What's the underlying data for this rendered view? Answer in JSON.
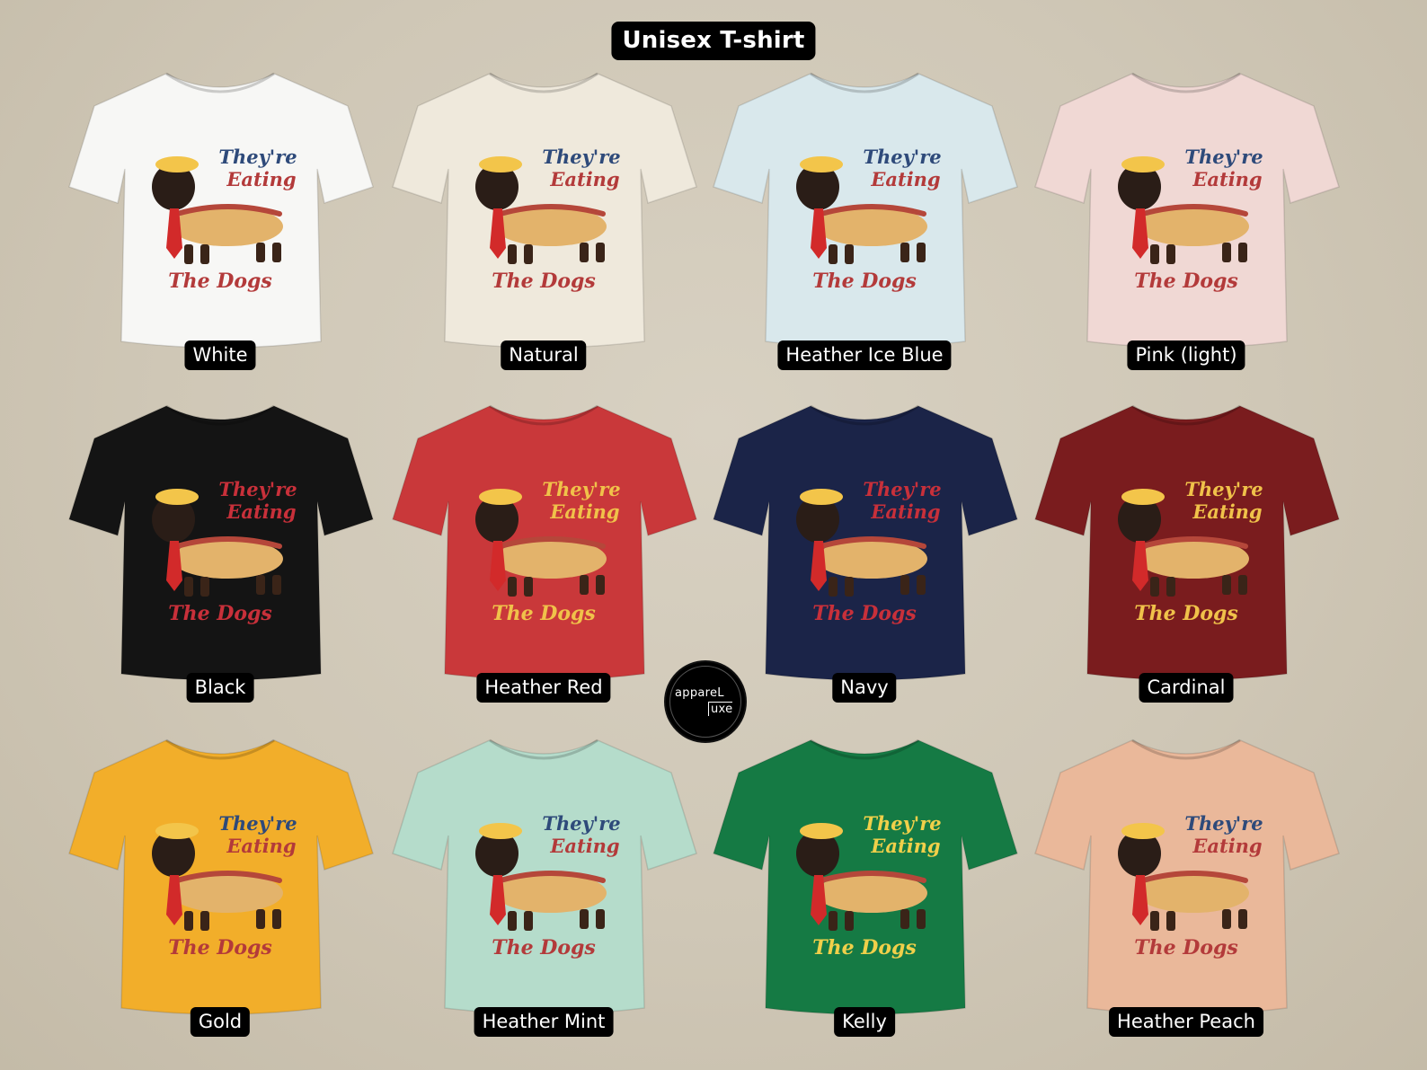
{
  "title": "Unisex T-shirt",
  "design": {
    "line1": "They're",
    "line2": "Eating",
    "line3": "The Dogs"
  },
  "logo": {
    "part1": "appareL",
    "part2": "uxe"
  },
  "shirts": [
    {
      "label": "White",
      "color": "#f7f7f5",
      "text1": "#2e4a7a",
      "text2": "#b33a3a"
    },
    {
      "label": "Natural",
      "color": "#efe9dc",
      "text1": "#2e4a7a",
      "text2": "#b33a3a"
    },
    {
      "label": "Heather Ice Blue",
      "color": "#d9e8ec",
      "text1": "#2e4a7a",
      "text2": "#b33a3a"
    },
    {
      "label": "Pink (light)",
      "color": "#f0d8d4",
      "text1": "#2e4a7a",
      "text2": "#b33a3a"
    },
    {
      "label": "Black",
      "color": "#141414",
      "text1": "#c8303a",
      "text2": "#c8303a"
    },
    {
      "label": "Heather Red",
      "color": "#c9383a",
      "text1": "#f0c24a",
      "text2": "#f0c24a"
    },
    {
      "label": "Navy",
      "color": "#1b2448",
      "text1": "#c8303a",
      "text2": "#c8303a"
    },
    {
      "label": "Cardinal",
      "color": "#7a1c1e",
      "text1": "#f0c24a",
      "text2": "#f0c24a"
    },
    {
      "label": "Gold",
      "color": "#f2ae2a",
      "text1": "#2e4a7a",
      "text2": "#b33a3a"
    },
    {
      "label": "Heather Mint",
      "color": "#b5dccb",
      "text1": "#2e4a7a",
      "text2": "#b33a3a"
    },
    {
      "label": "Kelly",
      "color": "#157a44",
      "text1": "#f0d04a",
      "text2": "#f0d04a"
    },
    {
      "label": "Heather Peach",
      "color": "#eab89a",
      "text1": "#2e4a7a",
      "text2": "#b33a3a"
    }
  ]
}
